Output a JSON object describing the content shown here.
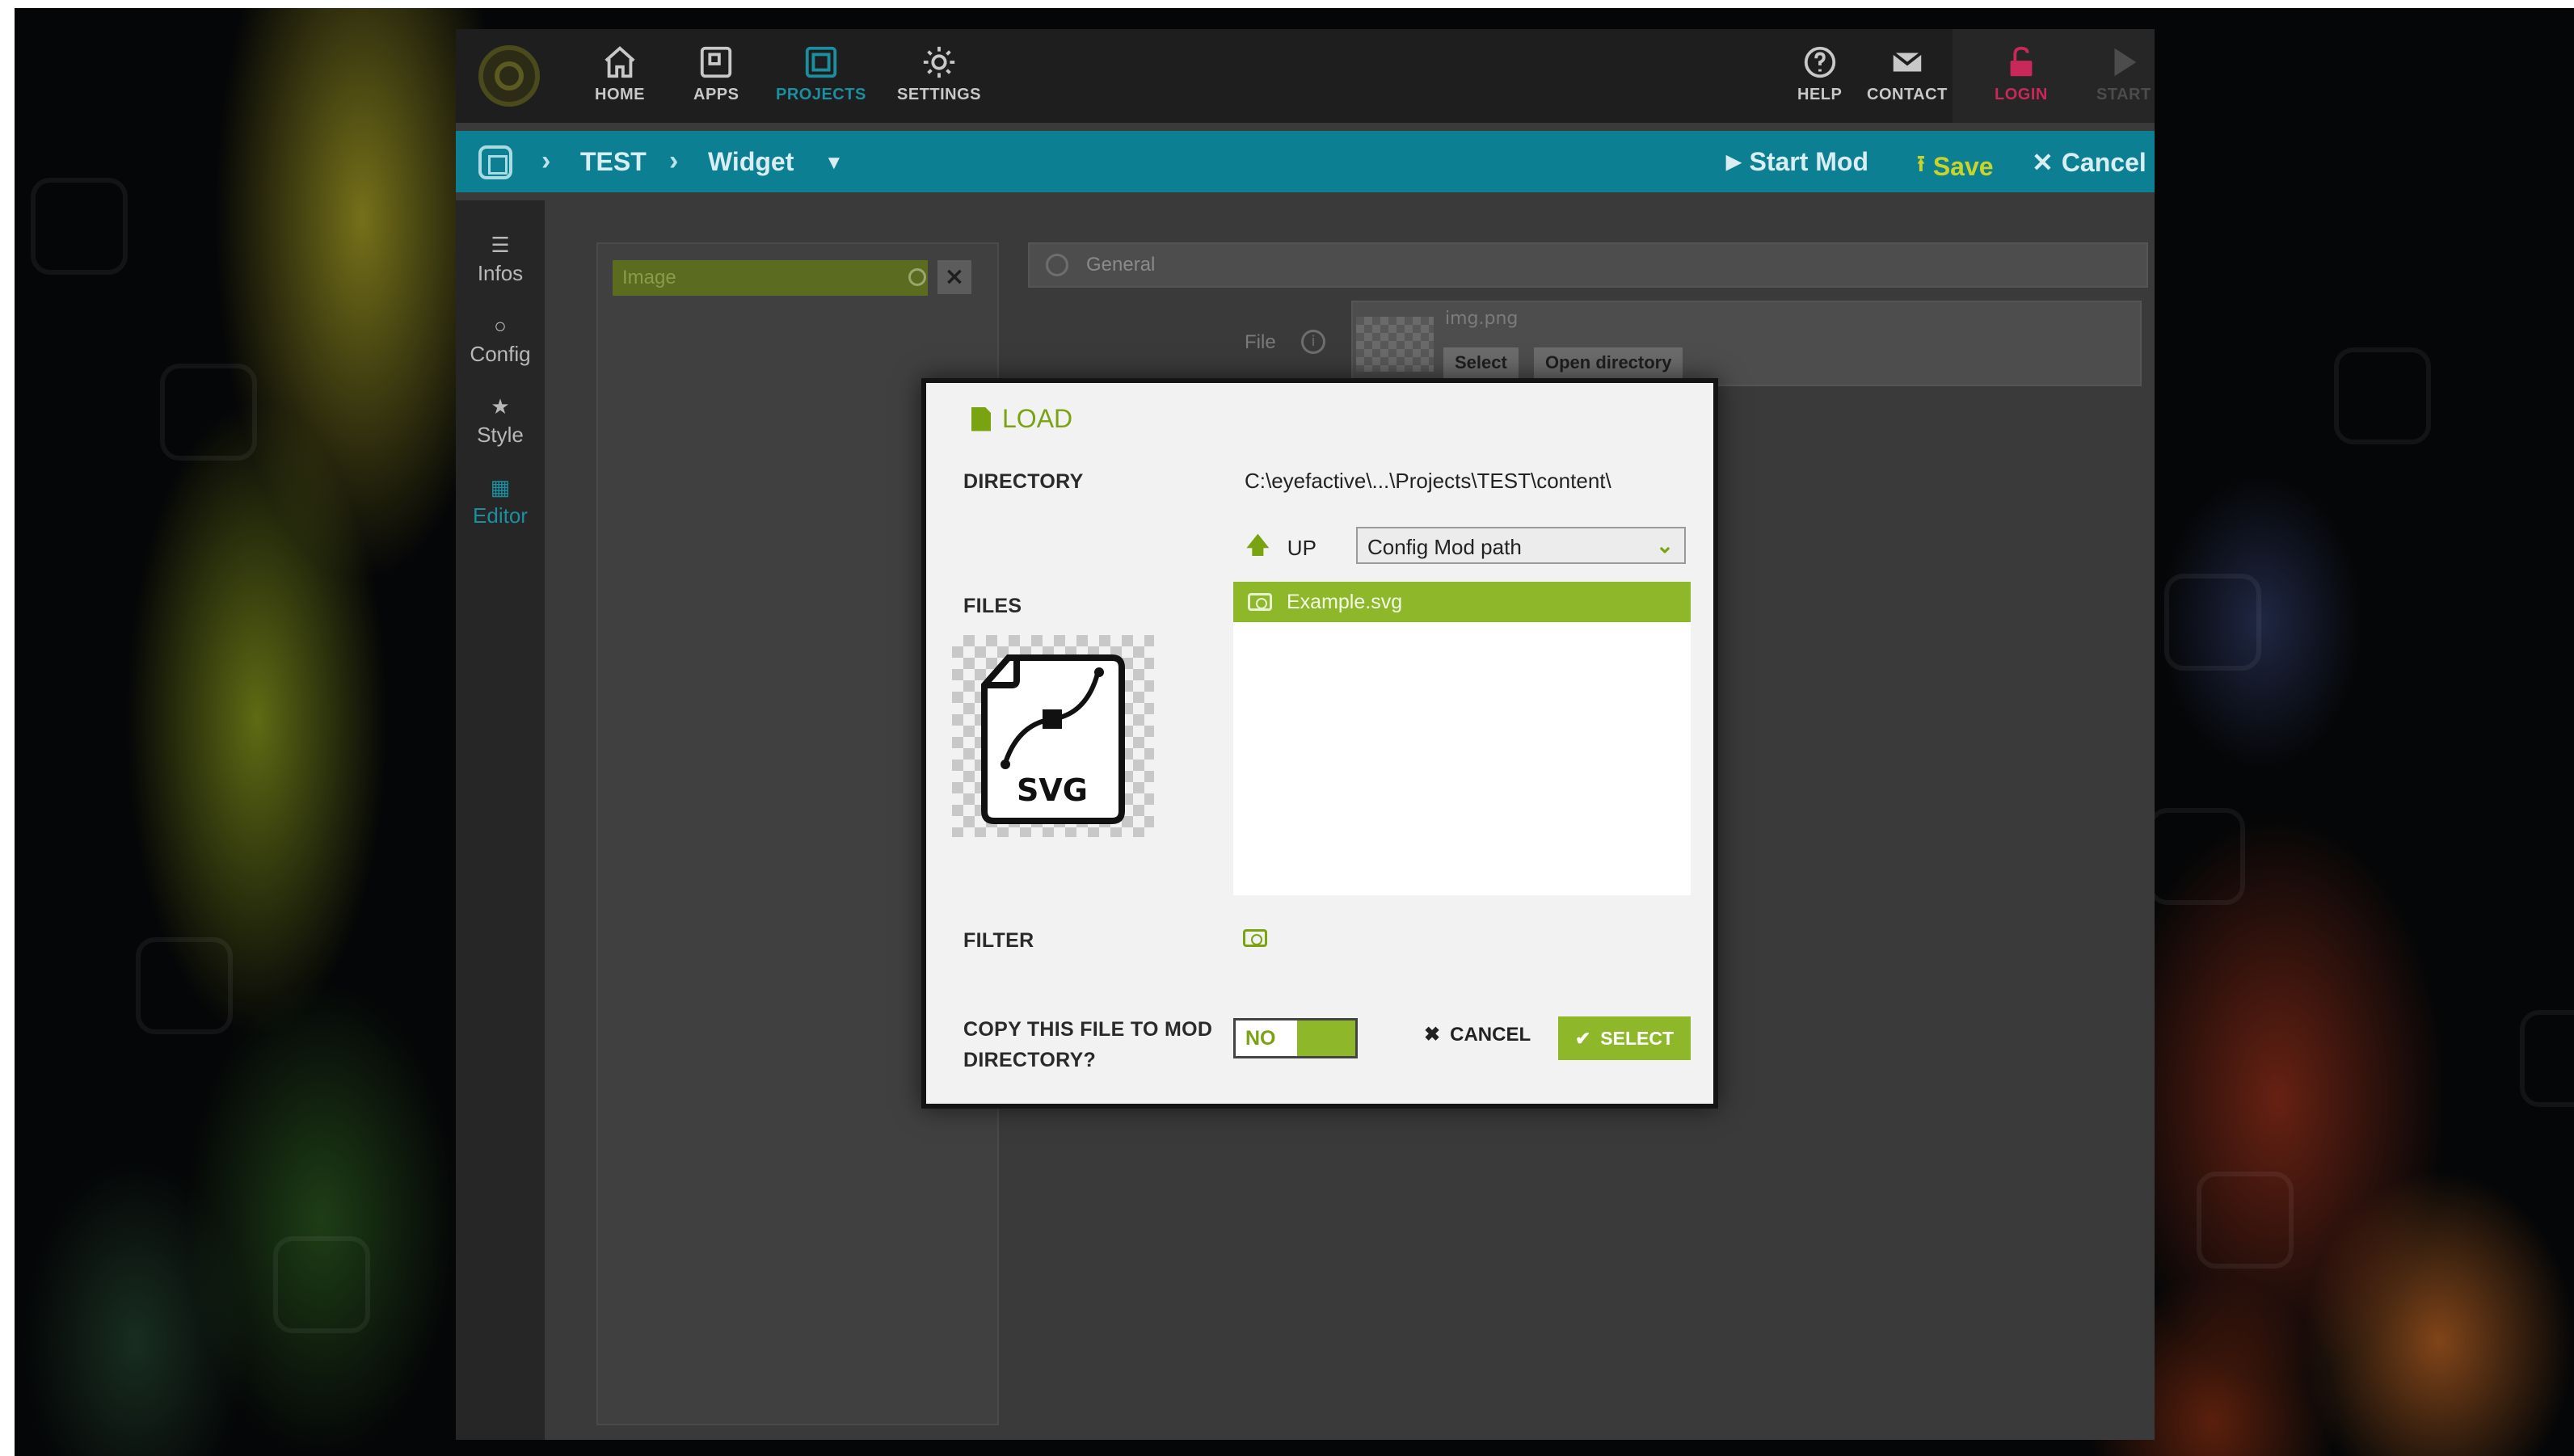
{
  "topbar": {
    "nav": [
      {
        "label": "HOME",
        "icon": "home-icon",
        "state": "normal"
      },
      {
        "label": "APPS",
        "icon": "apps-icon",
        "state": "normal"
      },
      {
        "label": "PROJECTS",
        "icon": "projects-icon",
        "state": "active"
      },
      {
        "label": "SETTINGS",
        "icon": "gear-icon",
        "state": "normal"
      }
    ],
    "right": [
      {
        "label": "HELP",
        "icon": "help-icon"
      },
      {
        "label": "CONTACT",
        "icon": "mail-icon"
      },
      {
        "label": "LOGIN",
        "icon": "lock-icon"
      },
      {
        "label": "START",
        "icon": "play-icon"
      }
    ]
  },
  "breadcrumb": {
    "project": "TEST",
    "widget": "Widget",
    "start_mod": "Start Mod",
    "save": "Save",
    "cancel": "Cancel"
  },
  "sidenav": [
    {
      "label": "Infos",
      "icon": "list-icon"
    },
    {
      "label": "Config",
      "icon": "circle-icon"
    },
    {
      "label": "Style",
      "icon": "star-icon"
    },
    {
      "label": "Editor",
      "icon": "grid-icon"
    }
  ],
  "leftpanel": {
    "search_value": "Image"
  },
  "properties": {
    "section": "General",
    "file_label": "File",
    "file_name": "img.png",
    "select_label": "Select",
    "open_directory_label": "Open directory"
  },
  "modal": {
    "title": "LOAD",
    "directory_label": "DIRECTORY",
    "directory_path": "C:\\eyefactive\\...\\Projects\\TEST\\content\\",
    "up_label": "UP",
    "path_option": "Config Mod path",
    "files_label": "FILES",
    "files": [
      "Example.svg"
    ],
    "preview_text": "SVG",
    "filter_label": "FILTER",
    "copy_label_line1": "COPY THIS FILE TO MOD",
    "copy_label_line2": "DIRECTORY?",
    "toggle_value": "NO",
    "cancel_label": "CANCEL",
    "select_label": "SELECT"
  },
  "colors": {
    "accent_green": "#8eb82a",
    "accent_teal": "#0d7f92",
    "login_pink": "#c8285a",
    "save_yellow": "#c9d429"
  }
}
